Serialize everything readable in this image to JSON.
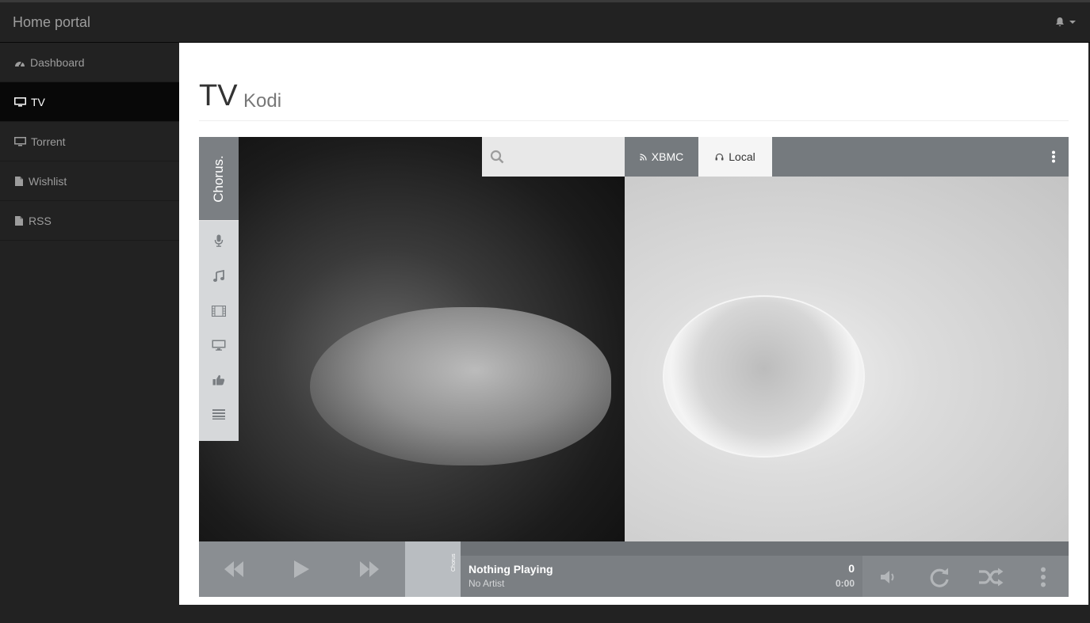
{
  "app": {
    "brand": "Home portal",
    "notifications_icon": "bell-icon"
  },
  "sidebar": {
    "items": [
      {
        "label": "Dashboard",
        "icon": "dashboard-icon",
        "active": false
      },
      {
        "label": "TV",
        "icon": "monitor-icon",
        "active": true
      },
      {
        "label": "Torrent",
        "icon": "monitor-icon",
        "active": false
      },
      {
        "label": "Wishlist",
        "icon": "document-icon",
        "active": false
      },
      {
        "label": "RSS",
        "icon": "document-icon",
        "active": false
      }
    ]
  },
  "page": {
    "title": "TV",
    "subtitle": "Kodi"
  },
  "kodi": {
    "logo": "Chorus.",
    "nav_icons": [
      "microphone-icon",
      "music-note-icon",
      "film-icon",
      "tv-icon",
      "thumbs-up-icon",
      "list-icon"
    ],
    "search": {
      "placeholder": "",
      "value": ""
    },
    "tabs": [
      {
        "label": "XBMC",
        "icon": "rss-icon",
        "active": false
      },
      {
        "label": "Local",
        "icon": "headphones-icon",
        "active": true
      }
    ],
    "player": {
      "thumb_label": "Chorus",
      "title": "Nothing Playing",
      "artist": "No Artist",
      "count": "0",
      "time": "0:00",
      "progress": 0
    },
    "colors": {
      "chrome": "#7b7f83",
      "nav_bg": "#d6d8da",
      "active_tab": "#f5f5f5"
    }
  }
}
